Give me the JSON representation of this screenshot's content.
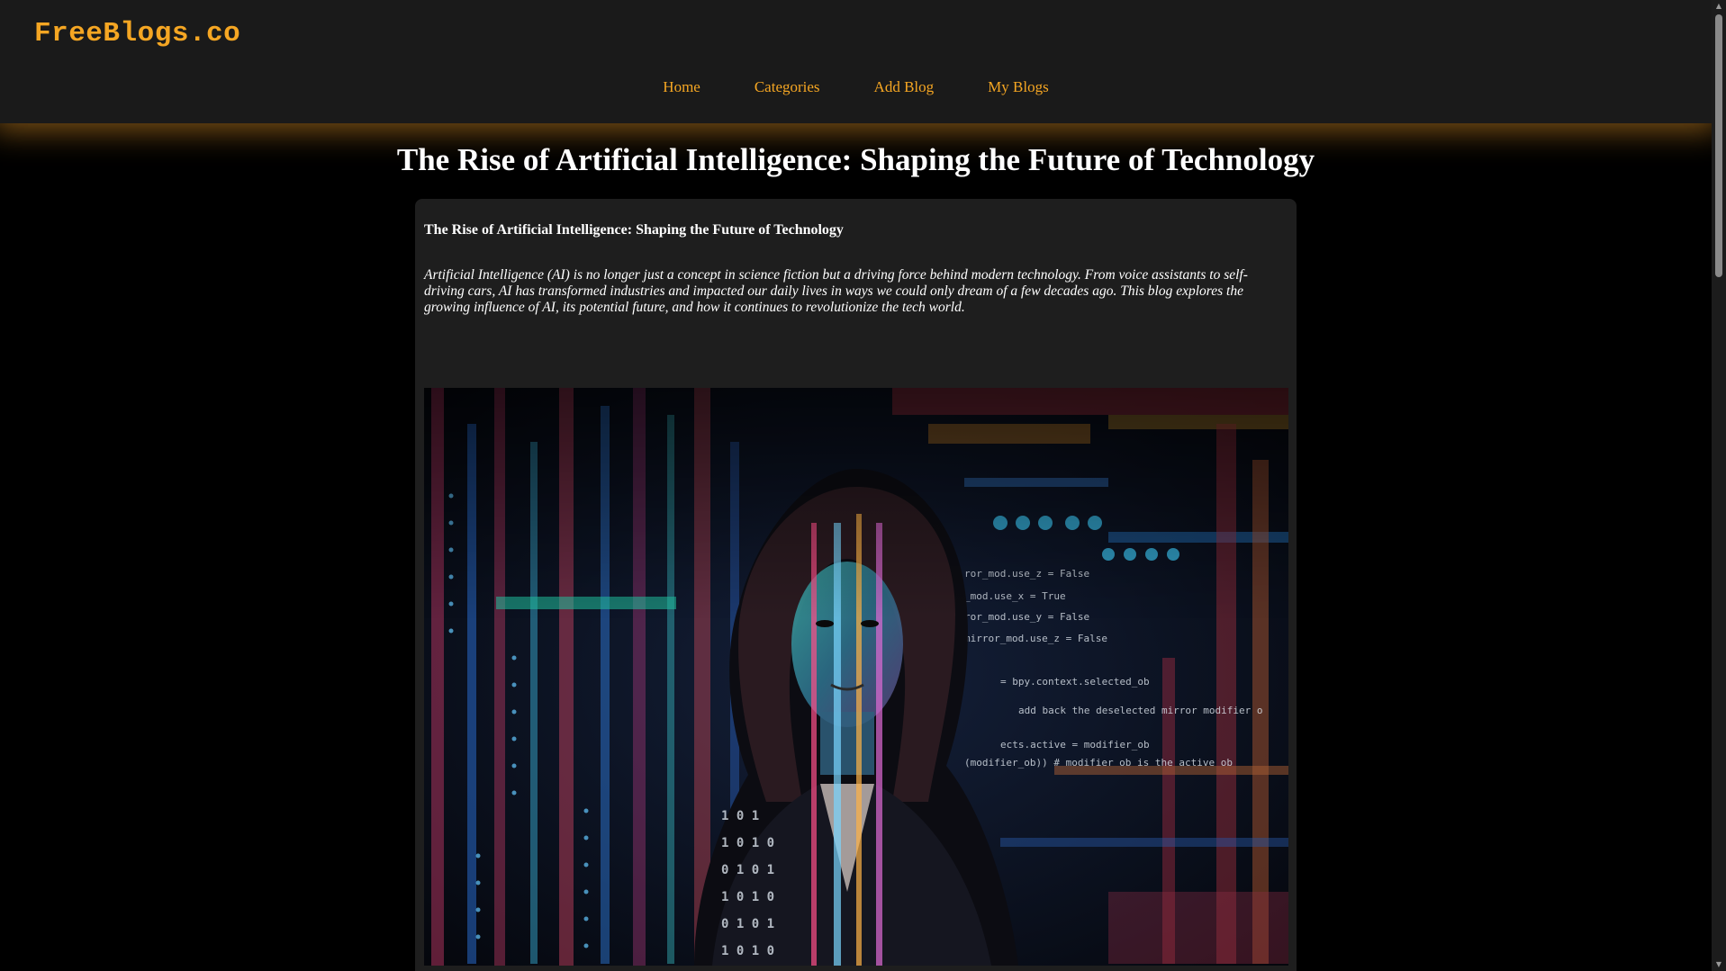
{
  "site": {
    "logo": "FreeBlogs.co"
  },
  "nav": {
    "items": [
      {
        "label": "Home"
      },
      {
        "label": "Categories"
      },
      {
        "label": "Add Blog"
      },
      {
        "label": "My Blogs"
      }
    ]
  },
  "page": {
    "title": "The Rise of Artificial Intelligence: Shaping the Future of Technology"
  },
  "post": {
    "title": "The Rise of Artificial Intelligence: Shaping the Future of Technology",
    "intro": "Artificial Intelligence (AI) is no longer just a concept in science fiction but a driving force behind modern technology. From voice assistants to self-driving cars, AI has transformed industries and impacted our daily lives in ways we could only dream of a few decades ago. This blog explores the growing influence of AI, its potential future, and how it continues to revolutionize the tech world.",
    "image_description": "woman-with-projected-code"
  },
  "colors": {
    "accent": "#f5a623",
    "header_bg": "#1a1a1a",
    "card_bg": "#1e1e1e",
    "page_bg": "#000000"
  },
  "scrollbar": {
    "up_icon": "▲",
    "down_icon": "▼"
  }
}
